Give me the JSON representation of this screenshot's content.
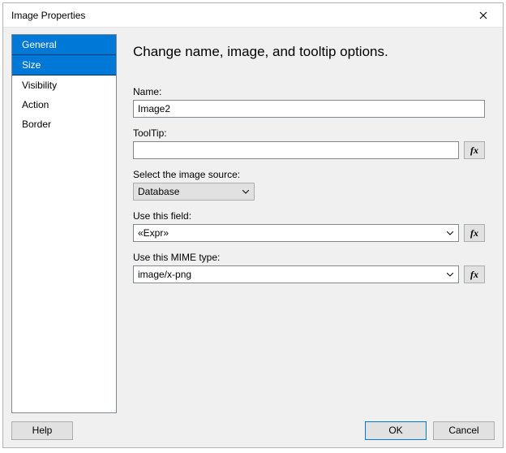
{
  "window": {
    "title": "Image Properties"
  },
  "sidebar": {
    "items": [
      {
        "label": "General"
      },
      {
        "label": "Size"
      },
      {
        "label": "Visibility"
      },
      {
        "label": "Action"
      },
      {
        "label": "Border"
      }
    ]
  },
  "content": {
    "heading": "Change name, image, and tooltip options.",
    "name_label": "Name:",
    "name_value": "Image2",
    "tooltip_label": "ToolTip:",
    "tooltip_value": "",
    "source_label": "Select the image source:",
    "source_value": "Database",
    "field_label": "Use this field:",
    "field_value": "«Expr»",
    "mime_label": "Use this MIME type:",
    "mime_value": "image/x-png",
    "fx_label": "fx"
  },
  "footer": {
    "help": "Help",
    "ok": "OK",
    "cancel": "Cancel"
  }
}
